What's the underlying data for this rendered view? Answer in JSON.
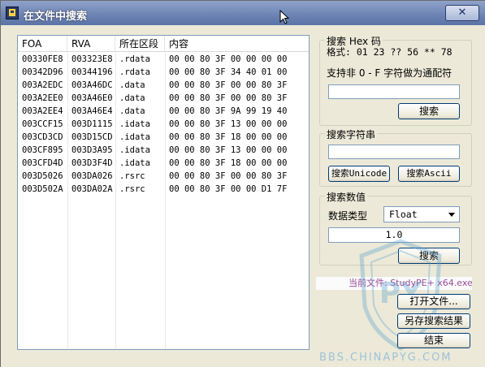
{
  "window": {
    "title": "在文件中搜索",
    "close_label": "✕"
  },
  "table": {
    "headers": [
      "FOA",
      "RVA",
      "所在区段",
      "内容"
    ],
    "rows": [
      [
        "00330FE8",
        "003323E8",
        ".rdata",
        "00 00 80 3F 00 00 00 00"
      ],
      [
        "00342D96",
        "00344196",
        ".rdata",
        "00 00 80 3F 34 40 01 00"
      ],
      [
        "003A2EDC",
        "003A46DC",
        ".data",
        "00 00 80 3F 00 00 80 3F"
      ],
      [
        "003A2EE0",
        "003A46E0",
        ".data",
        "00 00 80 3F 00 00 80 3F"
      ],
      [
        "003A2EE4",
        "003A46E4",
        ".data",
        "00 00 80 3F 9A 99 19 40"
      ],
      [
        "003CCF15",
        "003D1115",
        ".idata",
        "00 00 80 3F 13 00 00 00"
      ],
      [
        "003CD3CD",
        "003D15CD",
        ".idata",
        "00 00 80 3F 18 00 00 00"
      ],
      [
        "003CF895",
        "003D3A95",
        ".idata",
        "00 00 80 3F 13 00 00 00"
      ],
      [
        "003CFD4D",
        "003D3F4D",
        ".idata",
        "00 00 80 3F 18 00 00 00"
      ],
      [
        "003D5026",
        "003DA026",
        ".rsrc",
        "00 00 80 3F 00 00 80 3F"
      ],
      [
        "003D502A",
        "003DA02A",
        ".rsrc",
        "00 00 80 3F 00 00 D1 7F"
      ]
    ]
  },
  "hex_search": {
    "title": "搜索 Hex 码",
    "format": "格式: 01 23 ?? 56 ** 78",
    "hint": "支持非 0 - F 字符做为通配符",
    "value": "",
    "button": "搜索"
  },
  "string_search": {
    "title": "搜索字符串",
    "value": "",
    "unicode_button": "搜索Unicode",
    "ascii_button": "搜索Ascii"
  },
  "value_search": {
    "title": "搜索数值",
    "type_label": "数据类型",
    "type_value": "Float",
    "value": "1.0",
    "button": "搜索"
  },
  "current_file": "当前文件: StudyPE+ x64.exe",
  "actions": {
    "open_file": "打开文件...",
    "save_results": "另存搜索结果",
    "finish": "结束"
  },
  "watermark": "BBS.CHINAPYG.COM",
  "colors": {
    "title_bar": "#6c83b3",
    "window_bg": "#ece9d8",
    "current_file_text": "#9a4a9a"
  }
}
